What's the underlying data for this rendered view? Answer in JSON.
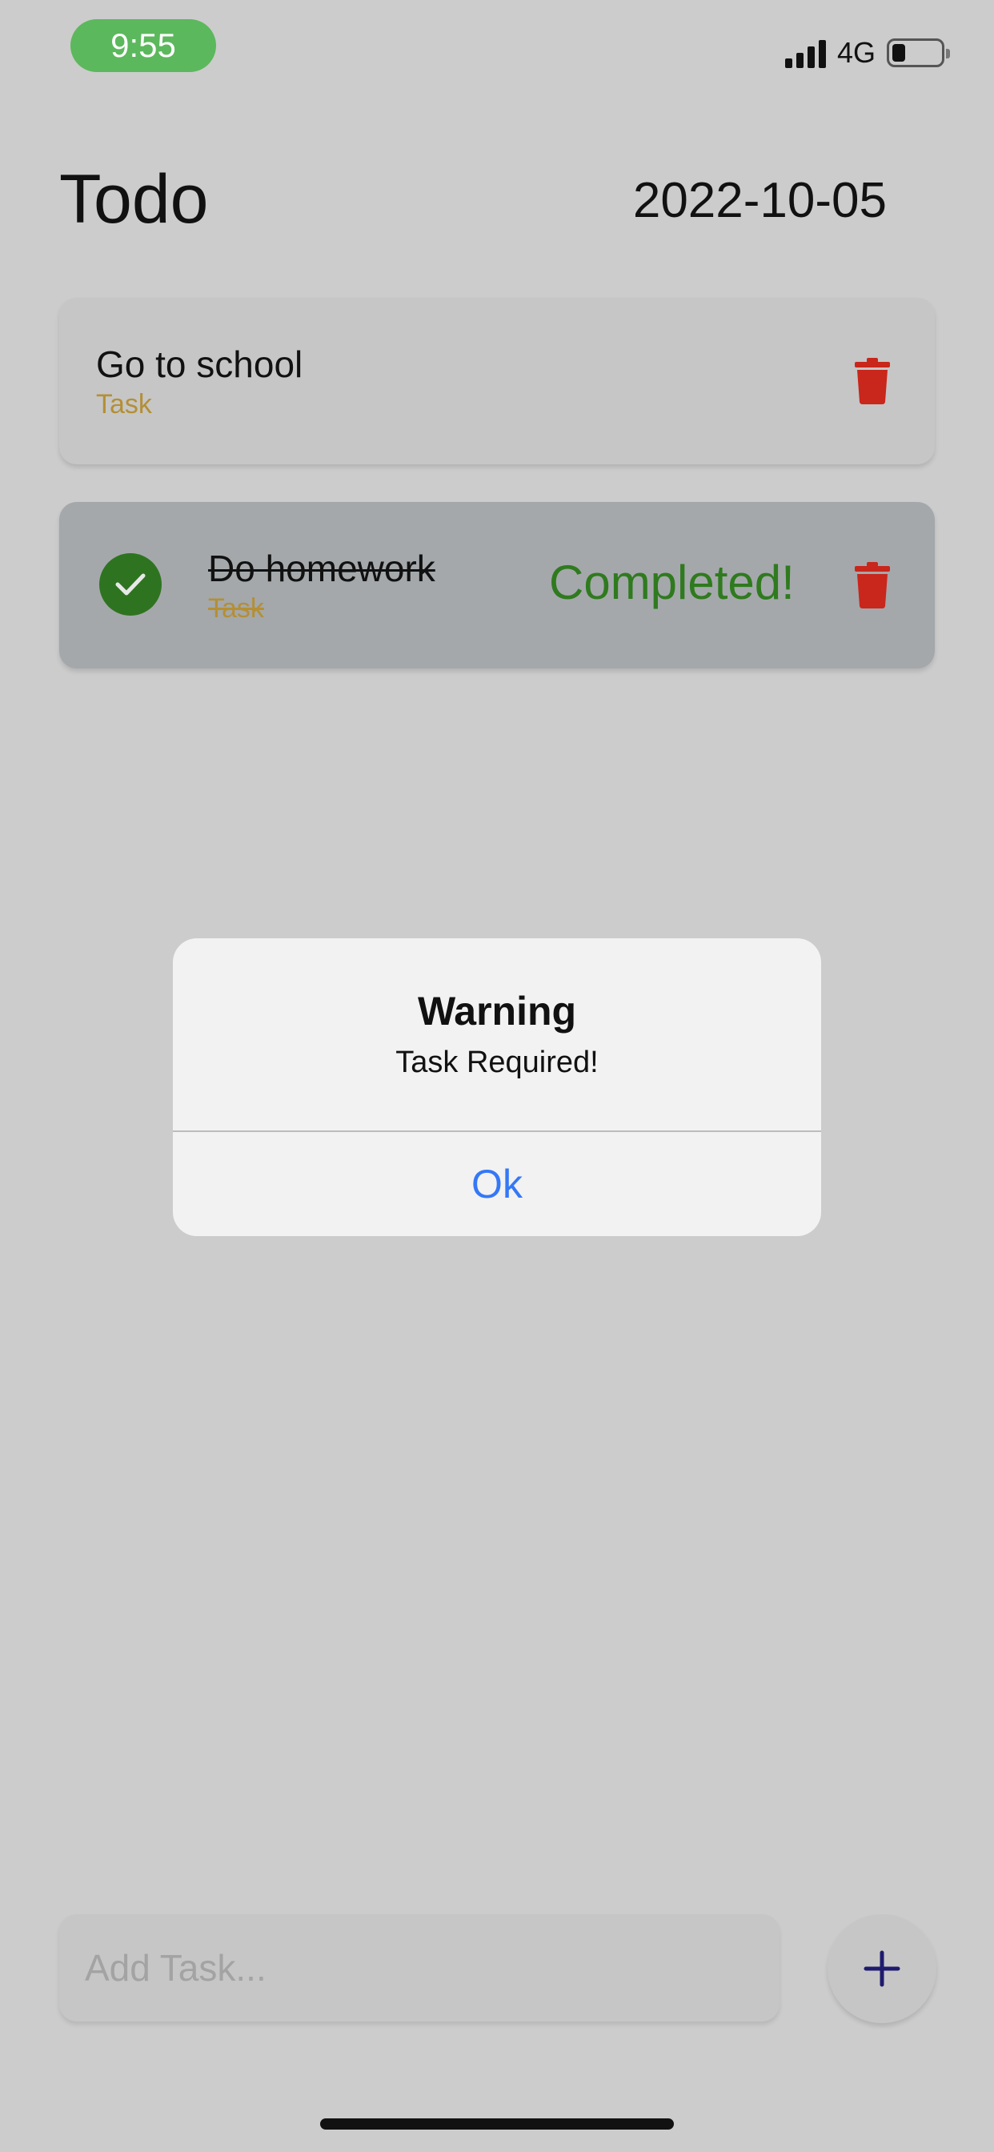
{
  "status_bar": {
    "time": "9:55",
    "network": "4G",
    "battery_level": 0.25,
    "signal_icon": "cellular-signal-icon",
    "battery_icon": "battery-icon"
  },
  "header": {
    "title": "Todo",
    "date": "2022-10-05"
  },
  "tasks": [
    {
      "title": "Go to school",
      "tag": "Task",
      "completed": false,
      "delete_icon": "trash-icon"
    },
    {
      "title": "Do homework",
      "tag": "Task",
      "completed": true,
      "status_label": "Completed!",
      "check_icon": "checkmark-circle-icon",
      "delete_icon": "trash-icon"
    }
  ],
  "alert": {
    "title": "Warning",
    "message": "Task Required!",
    "button_label": "Ok"
  },
  "add_task": {
    "placeholder": "Add Task...",
    "value": "",
    "button_icon": "plus-icon"
  },
  "colors": {
    "background": "#cccccc",
    "tag": "#b48f35",
    "completed_green": "#2f7a1e",
    "delete_red": "#c9261c",
    "link_blue": "#3478f6",
    "plus_navy": "#1e1b6e",
    "time_pill": "#5cb85c"
  }
}
